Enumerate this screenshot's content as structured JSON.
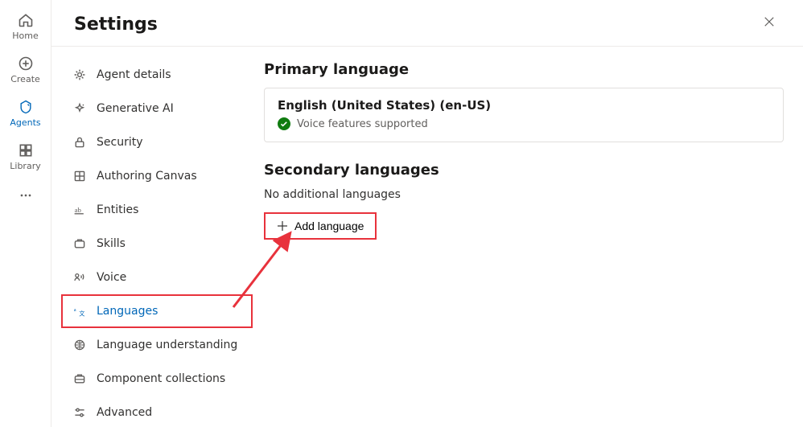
{
  "rail": {
    "items": [
      {
        "label": "Home"
      },
      {
        "label": "Create"
      },
      {
        "label": "Agents"
      },
      {
        "label": "Library"
      }
    ]
  },
  "header": {
    "title": "Settings"
  },
  "settingsNav": {
    "items": [
      {
        "label": "Agent details"
      },
      {
        "label": "Generative AI"
      },
      {
        "label": "Security"
      },
      {
        "label": "Authoring Canvas"
      },
      {
        "label": "Entities"
      },
      {
        "label": "Skills"
      },
      {
        "label": "Voice"
      },
      {
        "label": "Languages"
      },
      {
        "label": "Language understanding"
      },
      {
        "label": "Component collections"
      },
      {
        "label": "Advanced"
      }
    ]
  },
  "primary": {
    "heading": "Primary language",
    "name": "English (United States) (en-US)",
    "voiceText": "Voice features supported"
  },
  "secondary": {
    "heading": "Secondary languages",
    "emptyText": "No additional languages",
    "addLabel": "Add language"
  }
}
